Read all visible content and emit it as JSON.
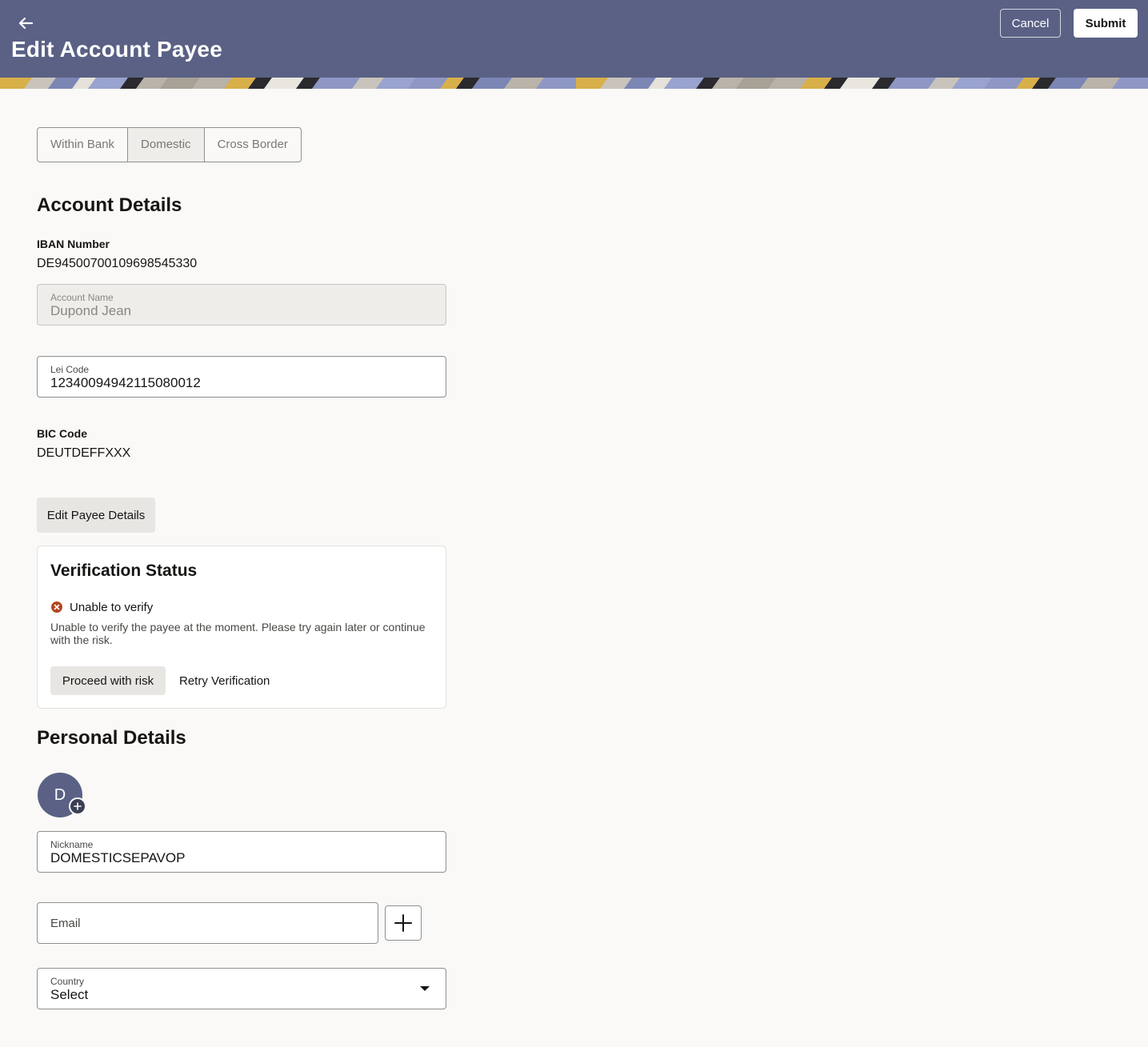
{
  "header": {
    "title": "Edit Account Payee",
    "cancel_label": "Cancel",
    "submit_label": "Submit"
  },
  "tabs": [
    {
      "label": "Within Bank",
      "selected": false
    },
    {
      "label": "Domestic",
      "selected": true
    },
    {
      "label": "Cross Border",
      "selected": false
    }
  ],
  "account_details": {
    "title": "Account Details",
    "iban_label": "IBAN Number",
    "iban_value": "DE94500700109698545330",
    "account_name_label": "Account Name",
    "account_name_value": "Dupond Jean",
    "lei_label": "Lei Code",
    "lei_value": "12340094942115080012",
    "bic_label": "BIC Code",
    "bic_value": "DEUTDEFFXXX",
    "edit_button": "Edit Payee Details"
  },
  "verification": {
    "title": "Verification Status",
    "status": "Unable to verify",
    "message": "Unable to verify the payee at the moment. Please try again later or continue with the risk.",
    "proceed_label": "Proceed with risk",
    "retry_label": "Retry Verification"
  },
  "personal_details": {
    "title": "Personal Details",
    "avatar_initial": "D",
    "nickname_label": "Nickname",
    "nickname_value": "DOMESTICSEPAVOP",
    "email_placeholder": "Email",
    "country_label": "Country",
    "country_value": "Select"
  },
  "colors": {
    "header_bg": "#5a6185",
    "error": "#b3461f"
  }
}
